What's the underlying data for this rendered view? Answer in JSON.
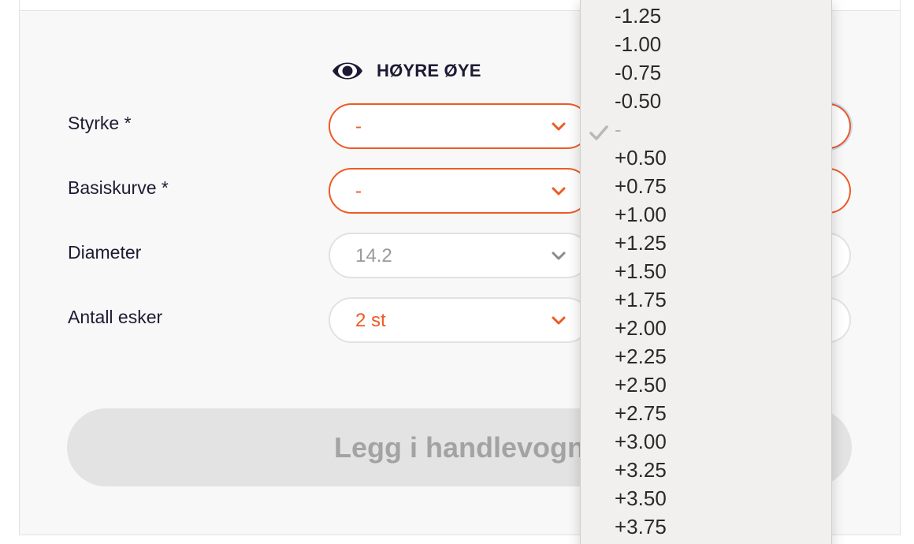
{
  "header": {
    "eye_title": "HØYRE ØYE"
  },
  "fields": [
    {
      "label": "Styrke *",
      "value": "-"
    },
    {
      "label": "Basiskurve  *",
      "value": "-"
    },
    {
      "label": "Diameter",
      "value": "14.2"
    },
    {
      "label": "Antall esker",
      "value": "2 st"
    }
  ],
  "cart_button": {
    "label": "Legg i handlevogn"
  },
  "dropdown": {
    "selected": "-",
    "options": [
      "-1.25",
      "-1.00",
      "-0.75",
      "-0.50",
      "-",
      "+0.50",
      "+0.75",
      "+1.00",
      "+1.25",
      "+1.50",
      "+1.75",
      "+2.00",
      "+2.25",
      "+2.50",
      "+2.75",
      "+3.00",
      "+3.25",
      "+3.50",
      "+3.75"
    ]
  },
  "colors": {
    "accent": "#ee5a24",
    "text": "#1f1a33",
    "disabled_button": "#e3e3e3"
  },
  "icons": {
    "eye": "eye-icon",
    "chevron": "chevron-down-icon",
    "check": "checkmark-icon"
  }
}
